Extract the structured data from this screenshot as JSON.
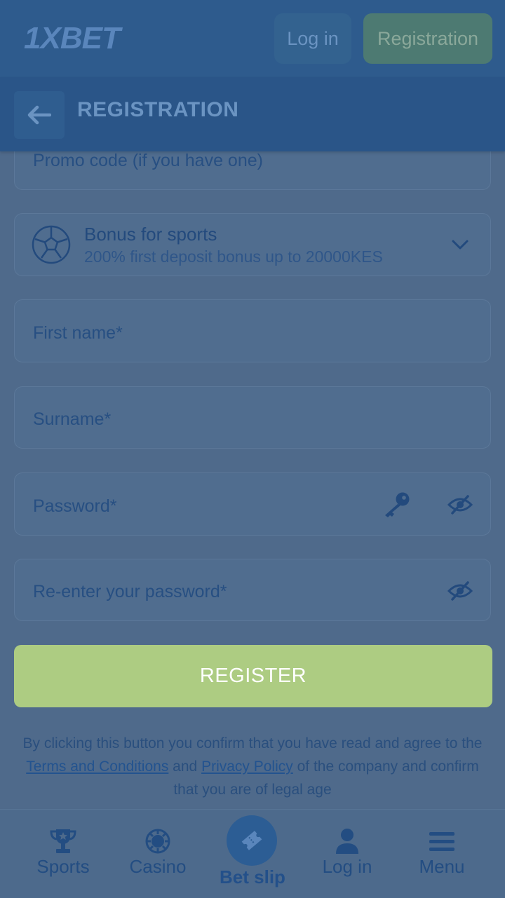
{
  "header": {
    "logo_text": "1XBET",
    "login_label": "Log in",
    "registration_label": "Registration"
  },
  "subheader": {
    "title": "REGISTRATION"
  },
  "form": {
    "promo_placeholder": "Promo code (if you have one)",
    "bonus_title": "Bonus for sports",
    "bonus_subtitle": "200% first deposit bonus up to 20000KES",
    "first_name_placeholder": "First name*",
    "surname_placeholder": "Surname*",
    "password_placeholder": "Password*",
    "reenter_password_placeholder": "Re-enter your password*",
    "register_label": "REGISTER"
  },
  "disclaimer": {
    "part1": "By clicking this button you confirm that you have read and agree to the ",
    "terms_link": "Terms and Conditions",
    "part2": " and ",
    "privacy_link": "Privacy Policy",
    "part3": " of the company and confirm that you are of legal age"
  },
  "bottom_nav": {
    "sports": "Sports",
    "casino": "Casino",
    "betslip": "Bet slip",
    "login": "Log in",
    "menu": "Menu"
  },
  "colors": {
    "overlay_bg": "#4f6a8b",
    "header_bg": "#2e5b8d",
    "register_button": "#adcc82",
    "registration_button": "#4d7a72"
  }
}
